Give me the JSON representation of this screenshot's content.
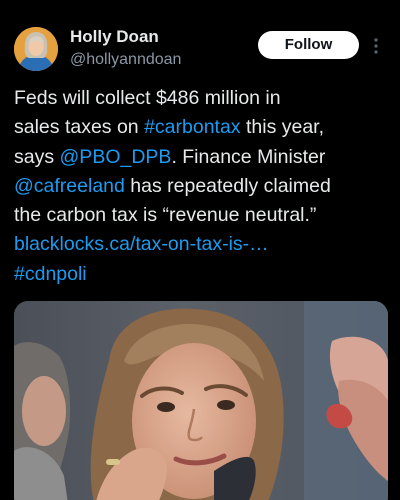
{
  "tweet": {
    "author": {
      "display_name": "Holly Doan",
      "handle": "@hollyanndoan"
    },
    "follow_label": "Follow",
    "text_lines": [
      [
        {
          "t": "Feds will collect $486 million in"
        }
      ],
      [
        {
          "t": "sales taxes on "
        },
        {
          "t": "#carbontax",
          "link": true
        },
        {
          "t": " this year,"
        }
      ],
      [
        {
          "t": "says "
        },
        {
          "t": "@PBO_DPB",
          "link": true
        },
        {
          "t": ". Finance Minister"
        }
      ],
      [
        {
          "t": "@cafreeland",
          "link": true
        },
        {
          "t": " has repeatedly claimed"
        }
      ],
      [
        {
          "t": "the carbon tax is “revenue neutral.”"
        }
      ],
      [
        {
          "t": "blacklocks.ca/tax-on-tax-is-…",
          "link": true
        }
      ],
      [
        {
          "t": "#cdnpoli",
          "link": true
        }
      ]
    ]
  },
  "icons": {
    "more": "more-vertical-icon"
  },
  "colors": {
    "background": "#000000",
    "primary_text": "#e7e9ea",
    "secondary_text": "#8b98a5",
    "link": "#1d9bf0",
    "follow_button_bg": "#ffffff",
    "follow_button_text": "#0f1419"
  }
}
